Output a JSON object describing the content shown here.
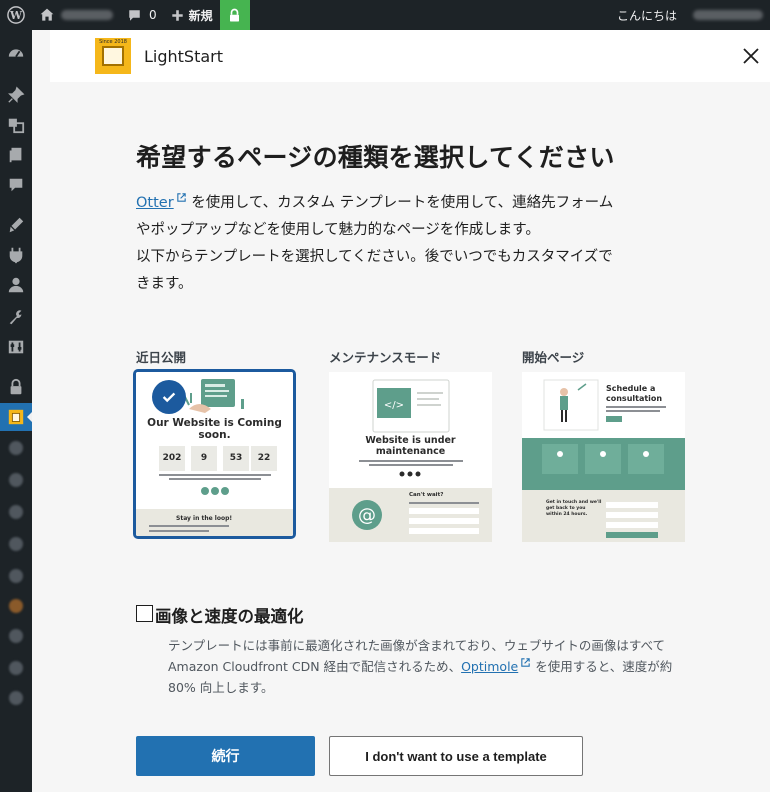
{
  "adminbar": {
    "comments_count": "0",
    "new_label": "新規",
    "greeting": "こんにちは"
  },
  "modal": {
    "brand": "LightStart",
    "title": "希望するページの種類を選択してください",
    "intro": {
      "otter_link": "Otter",
      "line1_rest": " を使用して、カスタム テンプレートを使用して、連絡先フォーム",
      "line2": "やポップアップなどを使用して魅力的なページを作成します。",
      "line3": "以下からテンプレートを選択してください。後でいつでもカスタマイズで",
      "line4": "きます。"
    },
    "templates": [
      {
        "label": "近日公開",
        "selected": true,
        "heading": "Our Website is Coming soon.",
        "countdown": [
          "202",
          "9",
          "53",
          "22"
        ],
        "footer": "Stay in the loop!"
      },
      {
        "label": "メンテナンスモード",
        "selected": false,
        "heading": "Website is under maintenance",
        "form_title": "Can't wait?"
      },
      {
        "label": "開始ページ",
        "selected": false,
        "heading": "Schedule a consultation",
        "form_title": "Get in touch and we'll get back to you within 24 hours."
      }
    ],
    "optimize": {
      "checked": false,
      "title": "画像と速度の最適化",
      "desc_before": "テンプレートには事前に最適化された画像が含まれており、ウェブサイトの画像はすべて Amazon Cloudfront CDN 経由で配信されるため、",
      "optimole_link": "Optimole",
      "desc_after": " を使用すると、速度が約 80% 向上します。"
    },
    "buttons": {
      "continue": "続行",
      "no_template": "I don't want to use a template"
    }
  },
  "colors": {
    "primary": "#2271b1",
    "selected_border": "#1c5a9e",
    "brand_yellow": "#f5b71a",
    "teal": "#5e9e8b",
    "lock_green": "#46b450"
  }
}
